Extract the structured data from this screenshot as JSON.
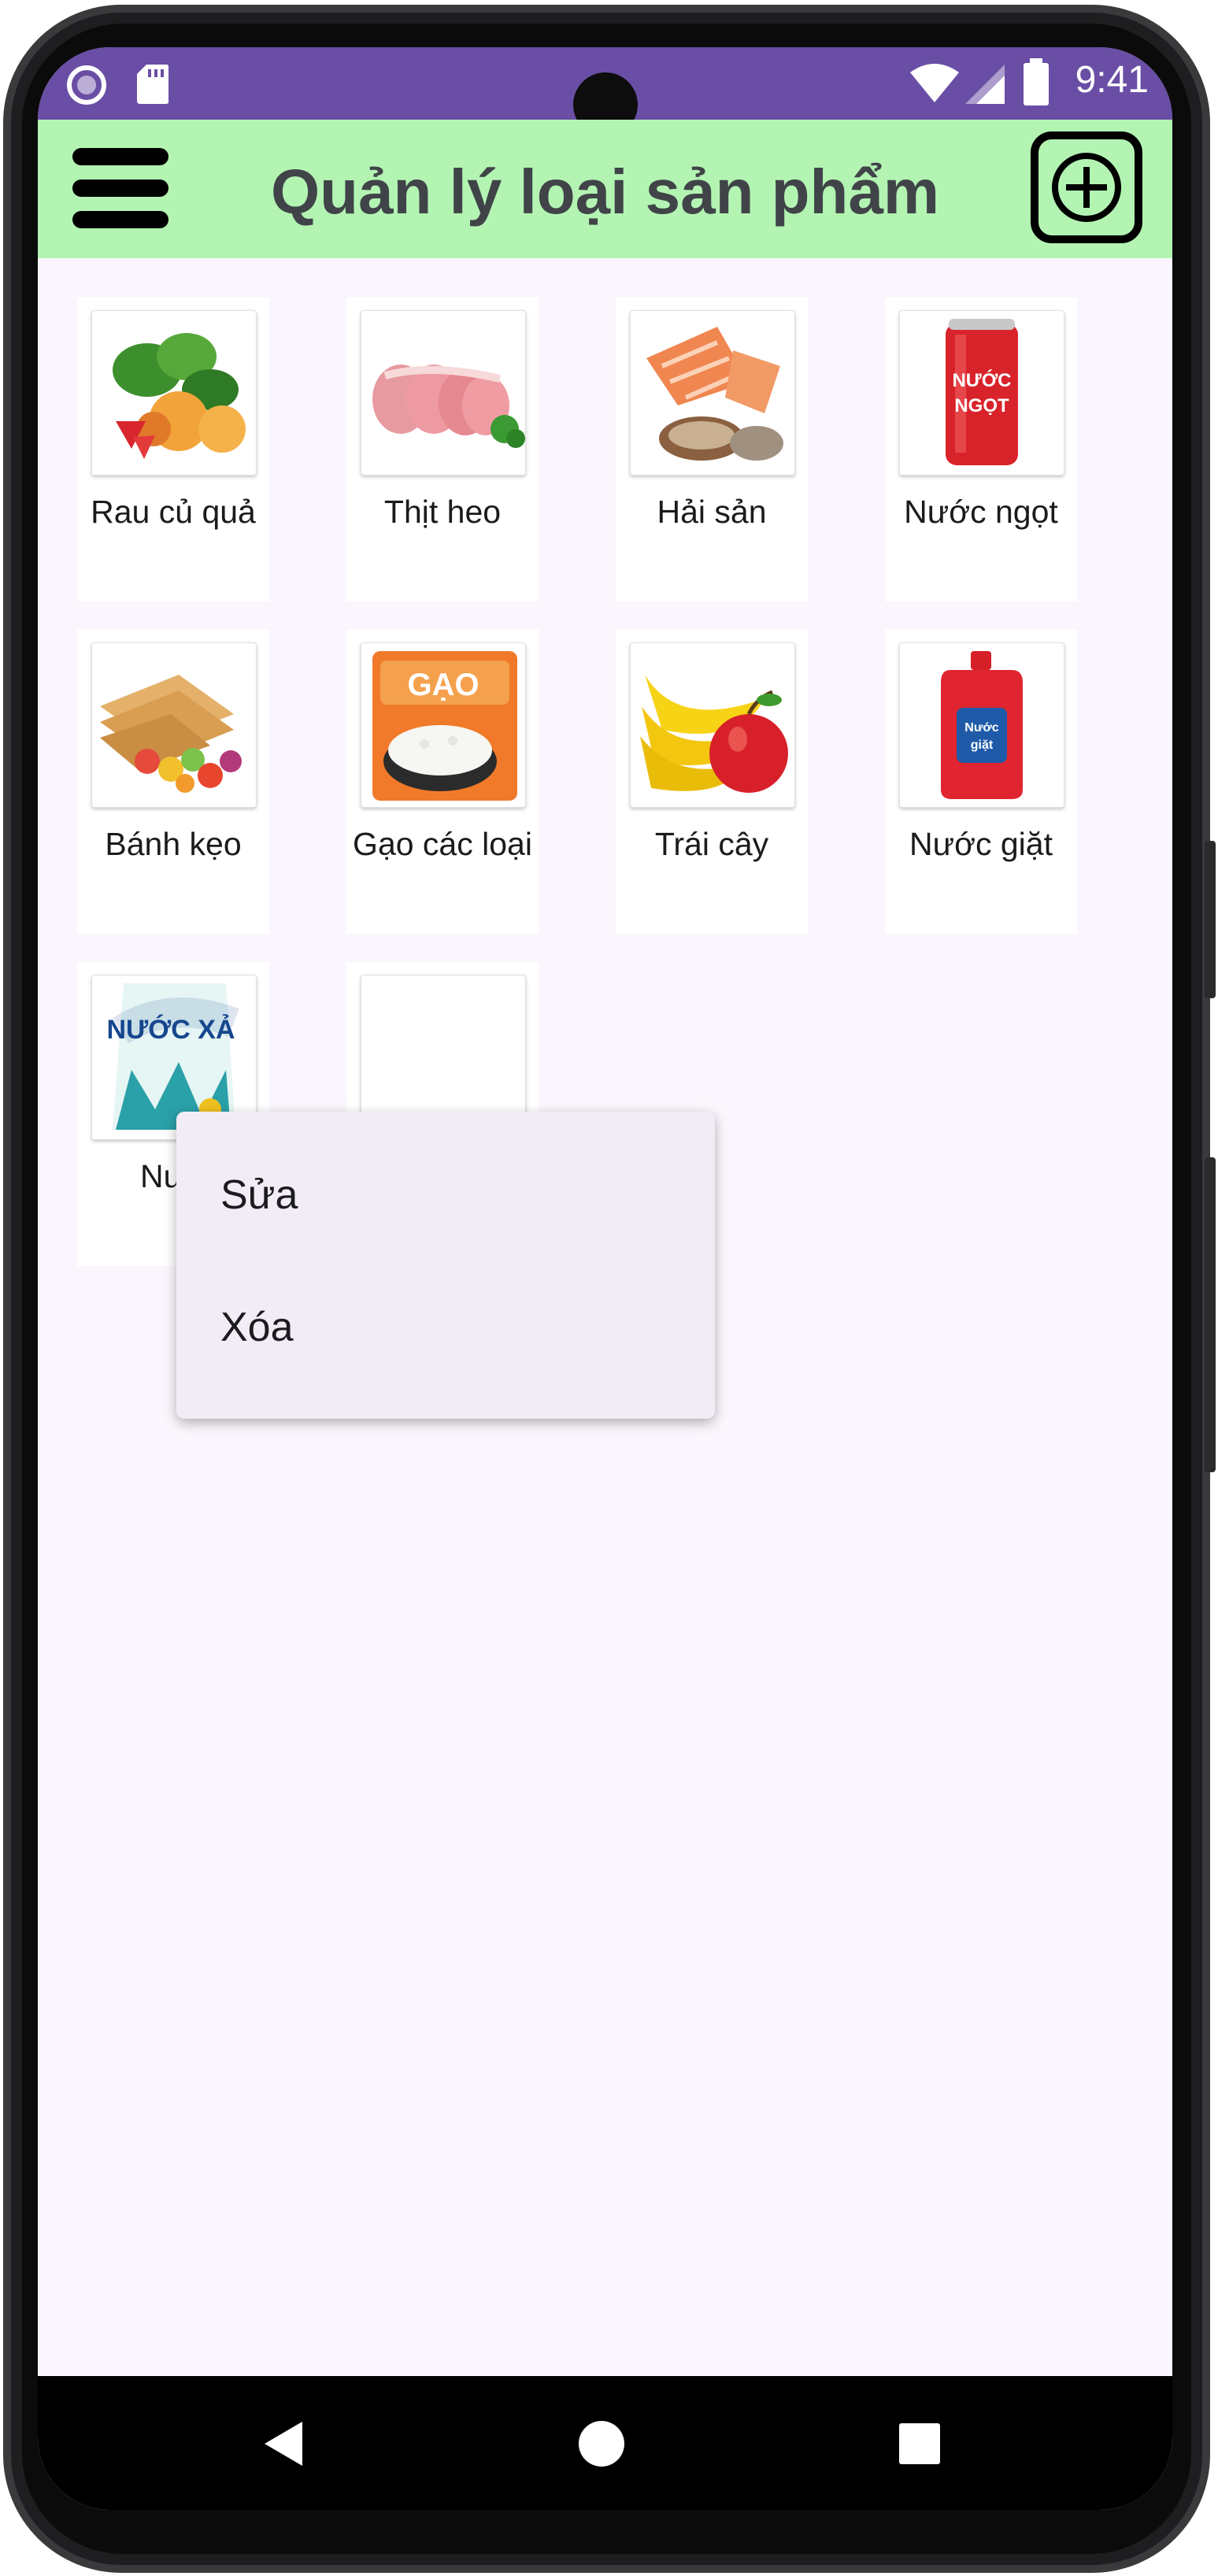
{
  "status_bar": {
    "time": "9:41"
  },
  "app_bar": {
    "title": "Quản lý loại sản phẩm"
  },
  "categories": [
    {
      "label": "Rau củ quả"
    },
    {
      "label": "Thịt heo"
    },
    {
      "label": "Hải sản"
    },
    {
      "label": "Nước ngọt"
    },
    {
      "label": "Bánh kẹo"
    },
    {
      "label": "Gạo các loại"
    },
    {
      "label": "Trái cây"
    },
    {
      "label": "Nước giặt"
    },
    {
      "label": "Nướ"
    },
    {
      "label": ""
    }
  ],
  "image_text": {
    "soda_can": "NƯỚC NGỌT",
    "rice_bag": "GẠO",
    "detergent": "Nước giặt",
    "softener": "NƯỚC XẢ"
  },
  "context_menu": {
    "edit": "Sửa",
    "delete": "Xóa"
  },
  "colors": {
    "status_bar": "#6a4ea5",
    "app_bar": "#b3f4b3",
    "screen_bg": "#fbf6fd",
    "menu_bg": "#f1ecf5"
  }
}
